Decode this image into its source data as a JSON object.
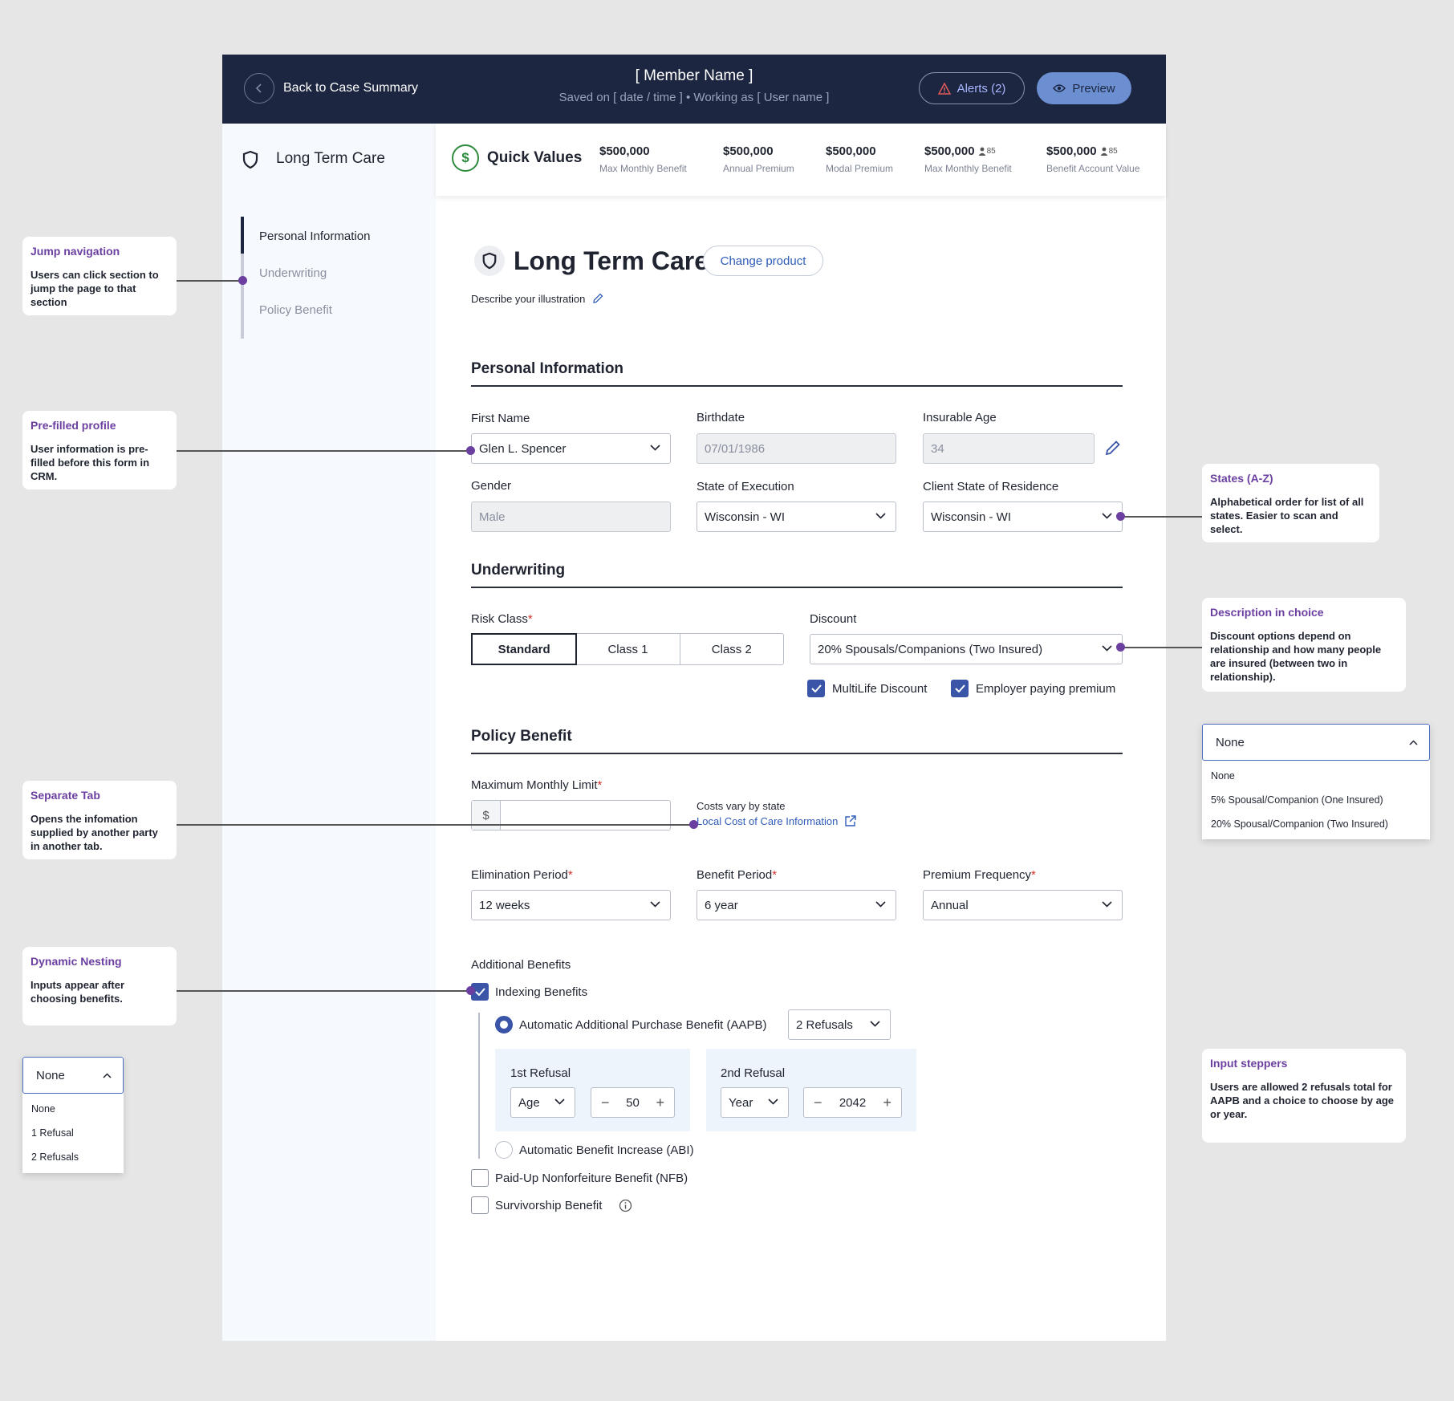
{
  "header": {
    "back_label": "Back to Case Summary",
    "member_name": "[ Member Name ]",
    "saved_line": "Saved on [ date / time ] • Working as [ User name ]",
    "alerts_label": "Alerts (2)",
    "preview_label": "Preview"
  },
  "sidebar": {
    "title": "Long Term Care",
    "items": [
      {
        "label": "Personal Information"
      },
      {
        "label": "Underwriting"
      },
      {
        "label": "Policy Benefit"
      }
    ]
  },
  "quick_values": {
    "title": "Quick Values",
    "items": [
      {
        "value": "$500,000",
        "label": "Max Monthly Benefit",
        "badge": ""
      },
      {
        "value": "$500,000",
        "label": "Annual Premium",
        "badge": ""
      },
      {
        "value": "$500,000",
        "label": "Modal Premium",
        "badge": ""
      },
      {
        "value": "$500,000",
        "label": "Max Monthly Benefit",
        "badge": "85"
      },
      {
        "value": "$500,000",
        "label": "Benefit Account Value",
        "badge": "85"
      }
    ]
  },
  "product": {
    "title": "Long Term Care",
    "change_label": "Change product",
    "describe_label": "Describe your illustration"
  },
  "personal": {
    "heading": "Personal Information",
    "first_name_label": "First Name",
    "first_name_value": "Glen L. Spencer",
    "birthdate_label": "Birthdate",
    "birthdate_value": "07/01/1986",
    "age_label": "Insurable Age",
    "age_value": "34",
    "gender_label": "Gender",
    "gender_value": "Male",
    "state_exec_label": "State of Execution",
    "state_exec_value": "Wisconsin - WI",
    "state_res_label": "Client State of Residence",
    "state_res_value": "Wisconsin - WI"
  },
  "underwriting": {
    "heading": "Underwriting",
    "risk_label": "Risk Class",
    "risk_options": [
      "Standard",
      "Class 1",
      "Class 2"
    ],
    "discount_label": "Discount",
    "discount_value": "20% Spousals/Companions (Two Insured)",
    "multilife_label": "MultiLife Discount",
    "employer_label": "Employer paying premium"
  },
  "policy": {
    "heading": "Policy Benefit",
    "max_limit_label": "Maximum Monthly Limit",
    "currency_symbol": "$",
    "costs_note": "Costs vary by state",
    "local_cost_link": "Local Cost of Care Information",
    "elimination_label": "Elimination Period",
    "elimination_value": "12 weeks",
    "benefit_period_label": "Benefit Period",
    "benefit_period_value": "6 year",
    "premium_freq_label": "Premium Frequency",
    "premium_freq_value": "Annual",
    "additional_label": "Additional Benefits",
    "indexing_label": "Indexing Benefits",
    "aapb_label": "Automatic Additional Purchase Benefit (AAPB)",
    "aapb_refusals_value": "2 Refusals",
    "refusal1_label": "1st Refusal",
    "refusal1_type": "Age",
    "refusal1_value": "50",
    "refusal2_label": "2nd Refusal",
    "refusal2_type": "Year",
    "refusal2_value": "2042",
    "abi_label": "Automatic Benefit Increase (ABI)",
    "nfb_label": "Paid-Up Nonforfeiture Benefit (NFB)",
    "survivorship_label": "Survivorship Benefit"
  },
  "annotations": {
    "jump": {
      "title": "Jump navigation",
      "body": "Users can click section to jump the page to that section"
    },
    "prefilled": {
      "title": "Pre-filled profile",
      "body": "User information is pre-filled before this form in CRM."
    },
    "separate": {
      "title": "Separate Tab",
      "body": "Opens the infomation supplied by another party in another tab."
    },
    "dynamic": {
      "title": "Dynamic Nesting",
      "body": "Inputs appear after choosing benefits."
    },
    "states": {
      "title": "States (A-Z)",
      "body": "Alphabetical order for list of all states. Easier to scan and select."
    },
    "description": {
      "title": "Description in choice",
      "body": "Discount options depend on relationship and how many people are insured (between two in relationship)."
    },
    "steppers": {
      "title": "Input steppers",
      "body": "Users are allowed 2 refusals total for AAPB and a choice to choose by age or year."
    }
  },
  "discount_dropdown": {
    "selected": "None",
    "options": [
      "None",
      "5% Spousal/Companion (One Insured)",
      "20% Spousal/Companion (Two Insured)"
    ]
  },
  "refusal_dropdown": {
    "selected": "None",
    "options": [
      "None",
      "1 Refusal",
      "2 Refusals"
    ]
  },
  "colors": {
    "header_bg": "#1c2640",
    "accent": "#3a55a8",
    "annotation_title": "#6b3fa0",
    "link": "#2f5cb8"
  }
}
